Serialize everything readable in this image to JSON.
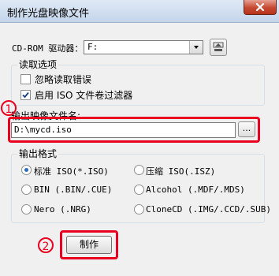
{
  "window": {
    "title": "制作光盘映像文件"
  },
  "drive": {
    "label": "CD-ROM 驱动器：",
    "value": "F:"
  },
  "read_options": {
    "title": "读取选项",
    "ignore_errors": {
      "label": "忽略读取错误",
      "checked": false
    },
    "iso_filter": {
      "label": "启用 ISO 文件卷过滤器",
      "checked": true
    }
  },
  "output_file": {
    "label": "输出映像文件名:",
    "value": "D:\\mycd.iso",
    "browse_label": "..."
  },
  "output_format": {
    "title": "输出格式",
    "options": [
      {
        "label": "标准 ISO(*.ISO)",
        "checked": true
      },
      {
        "label": "压缩 ISO(.ISZ)",
        "checked": false
      },
      {
        "label": "BIN (.BIN/.CUE)",
        "checked": false
      },
      {
        "label": "Alcohol (.MDF/.MDS)",
        "checked": false
      },
      {
        "label": "Nero (.NRG)",
        "checked": false
      },
      {
        "label": "CloneCD (.IMG/.CCD/.SUB)",
        "checked": false
      }
    ]
  },
  "actions": {
    "make_label": "制作"
  },
  "annotations": {
    "step1": "1",
    "step2": "2"
  },
  "colors": {
    "highlight": "#e8001e",
    "radio_dot": "#2a6cc8",
    "checkmark": "#1a3d8a"
  }
}
